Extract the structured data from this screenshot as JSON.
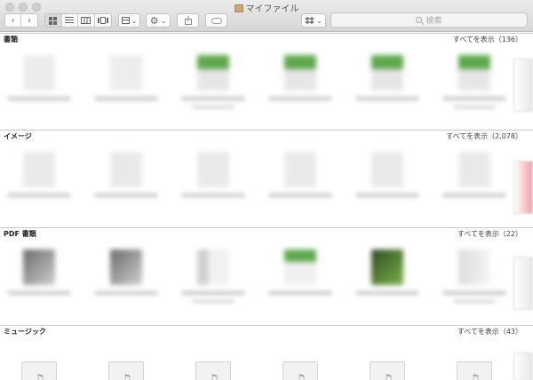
{
  "window": {
    "title": "マイファイル"
  },
  "toolbar": {
    "nav_back": "‹",
    "nav_forward": "›",
    "view_icons": [
      "icon-view-icon",
      "list-view-icon",
      "column-view-icon",
      "coverflow-view-icon"
    ],
    "arrange_caret": "⌄",
    "action_caret": "⌄",
    "dropbox_caret": "⌄",
    "search_placeholder": "検索"
  },
  "sections": [
    {
      "title": "書類",
      "link": "すべてを表示（136）"
    },
    {
      "title": "イメージ",
      "link": "すべてを表示（2,078）"
    },
    {
      "title": "PDF 書類",
      "link": "すべてを表示（22）"
    },
    {
      "title": "ミュージック",
      "link": "すべてを表示（43）"
    }
  ],
  "colors": {
    "toolbar_bg": "#dcdcdc",
    "thumb_green": "#5fa84f",
    "thumb_gray": "#cfcfcf",
    "thumb_dark": "#5a5a5a",
    "thumb_pink": "#f3a0a6"
  },
  "music_note": "♫"
}
